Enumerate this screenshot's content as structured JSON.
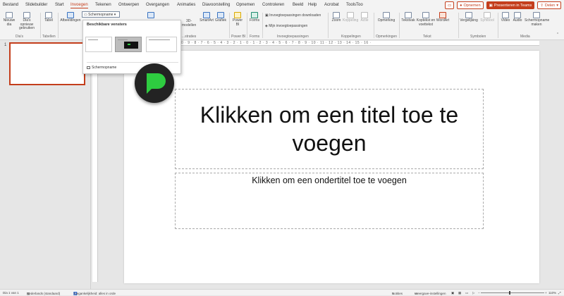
{
  "tabs": [
    "Bestand",
    "Slidebuilder",
    "Start",
    "Invoegen",
    "Tekenen",
    "Ontwerpen",
    "Overgangen",
    "Animaties",
    "Diavoorstelling",
    "Opnemen",
    "Controleren",
    "Beeld",
    "Help",
    "Acrobat",
    "ToolsToo"
  ],
  "active_tab": "Invoegen",
  "top_buttons": {
    "opnemen": "Opnemen",
    "teams": "Presenteren in Teams",
    "delen": "Delen"
  },
  "ribbon": {
    "nieuwe_dia": "Nieuwe dia",
    "dias_opnieuw": "Dia's opnieuw gebruiken",
    "tabel": "Tabel",
    "afbeeldingen": "Afbeeldingen",
    "schermopname_dd": "Schermopname",
    "modellen_3d": "3D-modellen",
    "smartart": "SmartArt",
    "grafiek": "Grafiek",
    "power_bi": "Power BI",
    "forms": "Forms",
    "invoeg_downloaden": "Invoegtoepassingen downloaden",
    "mijn_invoeg": "Mijn invoegtoepassingen",
    "zoom": "Zoom",
    "koppeling": "Koppeling",
    "actie": "Actie",
    "opmerking": "Opmerking",
    "tekstvak": "Tekstvak",
    "koptekst": "Koptekst en voettekst",
    "wordart": "WordArt",
    "vergelijking": "Vergelijking",
    "symbool": "Symbool",
    "video": "Video",
    "audio": "Audio",
    "schermopname_maken": "Schermopname maken",
    "groups": {
      "dias": "Dia's",
      "tabellen": "Tabellen",
      "illustraties": "...straties",
      "power_bi": "Power BI",
      "forms": "Forms",
      "invoegtoepassingen": "Invoegtoepassingen",
      "koppelingen": "Koppelingen",
      "opmerkingen": "Opmerkingen",
      "tekst": "Tekst",
      "symbolen": "Symbolen",
      "media": "Media"
    }
  },
  "popup": {
    "header": "Beschikbare vensters",
    "footer": "Schermopname"
  },
  "thumbnail_number": "1",
  "ruler_text": "· 16 · 15 · 14 · 13 · 12 · 11 · 10 · 9 · 8 · 7 · 6 · 5 · 4 · 3 · 2 · 1 · 0 · 1 · 2 · 3 · 4 · 5 · 6 · 7 · 8 · 9 · 10 · 11 · 12 · 13 · 14 · 15 · 16 ·",
  "slide": {
    "title_placeholder": "Klikken om een titel toe te voegen",
    "subtitle_placeholder": "Klikken om een ondertitel toe te voegen"
  },
  "status": {
    "dia": "Dia 1 van 1",
    "taal": "Nederlands (standaard)",
    "toegankelijkheid": "Toegankelijkheid: alles in orde",
    "notities": "Notities",
    "weergave": "Weergave-instellingen",
    "zoom": "110%"
  },
  "colors": {
    "accent": "#c43e1c",
    "logo_green": "#2ecc40"
  }
}
